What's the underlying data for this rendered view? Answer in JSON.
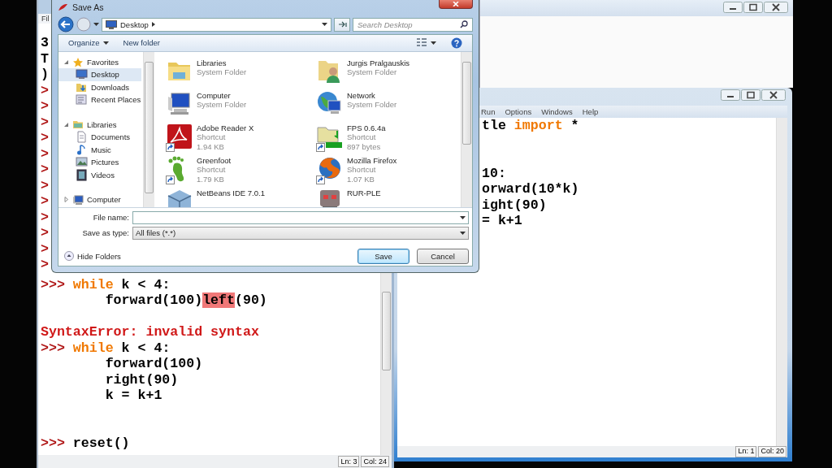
{
  "shell": {
    "menu": [
      "Fil"
    ],
    "left_strip": [
      {
        "kind": "code",
        "text": "3"
      },
      {
        "kind": "code",
        "text": "T"
      },
      {
        "kind": "code",
        "text": ")"
      },
      {
        "kind": "prompt",
        "text": ">"
      },
      {
        "kind": "prompt",
        "text": ">"
      },
      {
        "kind": "prompt",
        "text": ">"
      },
      {
        "kind": "prompt",
        "text": ">"
      },
      {
        "kind": "prompt",
        "text": ">"
      },
      {
        "kind": "prompt",
        "text": ">"
      },
      {
        "kind": "prompt",
        "text": ">"
      },
      {
        "kind": "prompt",
        "text": ">"
      },
      {
        "kind": "prompt",
        "text": ">"
      },
      {
        "kind": "prompt",
        "text": ">"
      },
      {
        "kind": "prompt",
        "text": ">"
      },
      {
        "kind": "prompt",
        "text": ">"
      }
    ],
    "lines": [
      {
        "kind": "code",
        "indent": false,
        "segments": [
          {
            "kind": "prompt",
            "text": ">>>"
          },
          {
            "kind": "keyword",
            "text": "while",
            "joined": false
          },
          {
            "kind": "code",
            "text": "k < 4:",
            "joined": false
          }
        ]
      },
      {
        "kind": "code",
        "indent": true,
        "segments": [
          {
            "kind": "code",
            "text": "forward(100)"
          },
          {
            "kind": "highlight",
            "text": "left",
            "joined": true
          },
          {
            "kind": "code",
            "text": "(90)",
            "joined": true
          }
        ]
      },
      {
        "kind": "blank"
      },
      {
        "kind": "code",
        "indent": false,
        "segments": [
          {
            "kind": "error",
            "text": "SyntaxError: invalid syntax"
          }
        ]
      },
      {
        "kind": "code",
        "indent": false,
        "segments": [
          {
            "kind": "prompt",
            "text": ">>>"
          },
          {
            "kind": "keyword",
            "text": "while",
            "joined": false
          },
          {
            "kind": "code",
            "text": "k < 4:",
            "joined": false
          }
        ]
      },
      {
        "kind": "code",
        "indent": true,
        "segments": [
          {
            "kind": "code",
            "text": "forward(100)"
          }
        ]
      },
      {
        "kind": "code",
        "indent": true,
        "segments": [
          {
            "kind": "code",
            "text": "right(90)"
          }
        ]
      },
      {
        "kind": "code",
        "indent": true,
        "segments": [
          {
            "kind": "code",
            "text": "k = k+1"
          }
        ]
      },
      {
        "kind": "blank"
      },
      {
        "kind": "blank"
      },
      {
        "kind": "code",
        "indent": false,
        "segments": [
          {
            "kind": "prompt",
            "text": ">>>"
          },
          {
            "kind": "code",
            "text": "reset()",
            "joined": false
          }
        ]
      }
    ],
    "status": [
      "Ln: 3",
      "Col: 24"
    ]
  },
  "editor": {
    "menu": [
      "Run",
      "Options",
      "Windows",
      "Help"
    ],
    "lines": [
      {
        "kind": "code",
        "indent": false,
        "segments": [
          {
            "kind": "code",
            "text": "tle"
          },
          {
            "kind": "keyword",
            "text": "import",
            "joined": false
          },
          {
            "kind": "code",
            "text": "*",
            "joined": false
          }
        ]
      },
      {
        "kind": "blank"
      },
      {
        "kind": "blank"
      },
      {
        "kind": "code",
        "indent": false,
        "segments": [
          {
            "kind": "code",
            "text": "10:"
          }
        ]
      },
      {
        "kind": "code",
        "indent": false,
        "segments": [
          {
            "kind": "code",
            "text": "orward(10*k)"
          }
        ]
      },
      {
        "kind": "code",
        "indent": false,
        "segments": [
          {
            "kind": "code",
            "text": "ight(90)"
          }
        ]
      },
      {
        "kind": "code",
        "indent": false,
        "segments": [
          {
            "kind": "code",
            "text": "= k+1"
          }
        ]
      }
    ],
    "status": [
      "Ln: 1",
      "Col: 20"
    ]
  },
  "dialog": {
    "title": "Save As",
    "address": "Desktop",
    "search_placeholder": "Search Desktop",
    "toolbar": [
      {
        "label": "Organize",
        "menu": true
      },
      {
        "label": "New folder",
        "menu": false
      }
    ],
    "nav": [
      {
        "label": "Favorites",
        "expanded": true,
        "selected": false,
        "children": [
          {
            "label": "Desktop",
            "selected": true
          },
          {
            "label": "Downloads",
            "selected": false
          },
          {
            "label": "Recent Places",
            "selected": false
          }
        ]
      },
      {
        "label": "Libraries",
        "expanded": true,
        "selected": false,
        "children": [
          {
            "label": "Documents",
            "selected": false
          },
          {
            "label": "Music",
            "selected": false
          },
          {
            "label": "Pictures",
            "selected": false
          },
          {
            "label": "Videos",
            "selected": false
          }
        ]
      },
      {
        "label": "Computer",
        "expanded": false,
        "selected": false
      }
    ],
    "files": [
      {
        "name": "Libraries",
        "type": "System Folder",
        "shortcut": false
      },
      {
        "name": "Jurgis Pralgauskis",
        "type": "System Folder",
        "shortcut": false
      },
      {
        "name": "Computer",
        "type": "System Folder",
        "shortcut": false
      },
      {
        "name": "Network",
        "type": "System Folder",
        "shortcut": false
      },
      {
        "name": "Adobe Reader X",
        "type": "Shortcut",
        "size": "1.94 KB",
        "shortcut": true
      },
      {
        "name": "FPS 0.6.4a",
        "type": "Shortcut",
        "size": "897 bytes",
        "shortcut": true
      },
      {
        "name": "Greenfoot",
        "type": "Shortcut",
        "size": "1.79 KB",
        "shortcut": true
      },
      {
        "name": "Mozilla Firefox",
        "type": "Shortcut",
        "size": "1.07 KB",
        "shortcut": true
      },
      {
        "name": "NetBeans IDE 7.0.1"
      },
      {
        "name": "RUR-PLE"
      }
    ],
    "file_name_label": "File name:",
    "save_type_label": "Save as type:",
    "save_type_value": "All files (*.*)",
    "hide_folders": "Hide Folders",
    "buttons": [
      {
        "label": "Save",
        "default": true
      },
      {
        "label": "Cancel",
        "default": false
      }
    ]
  }
}
